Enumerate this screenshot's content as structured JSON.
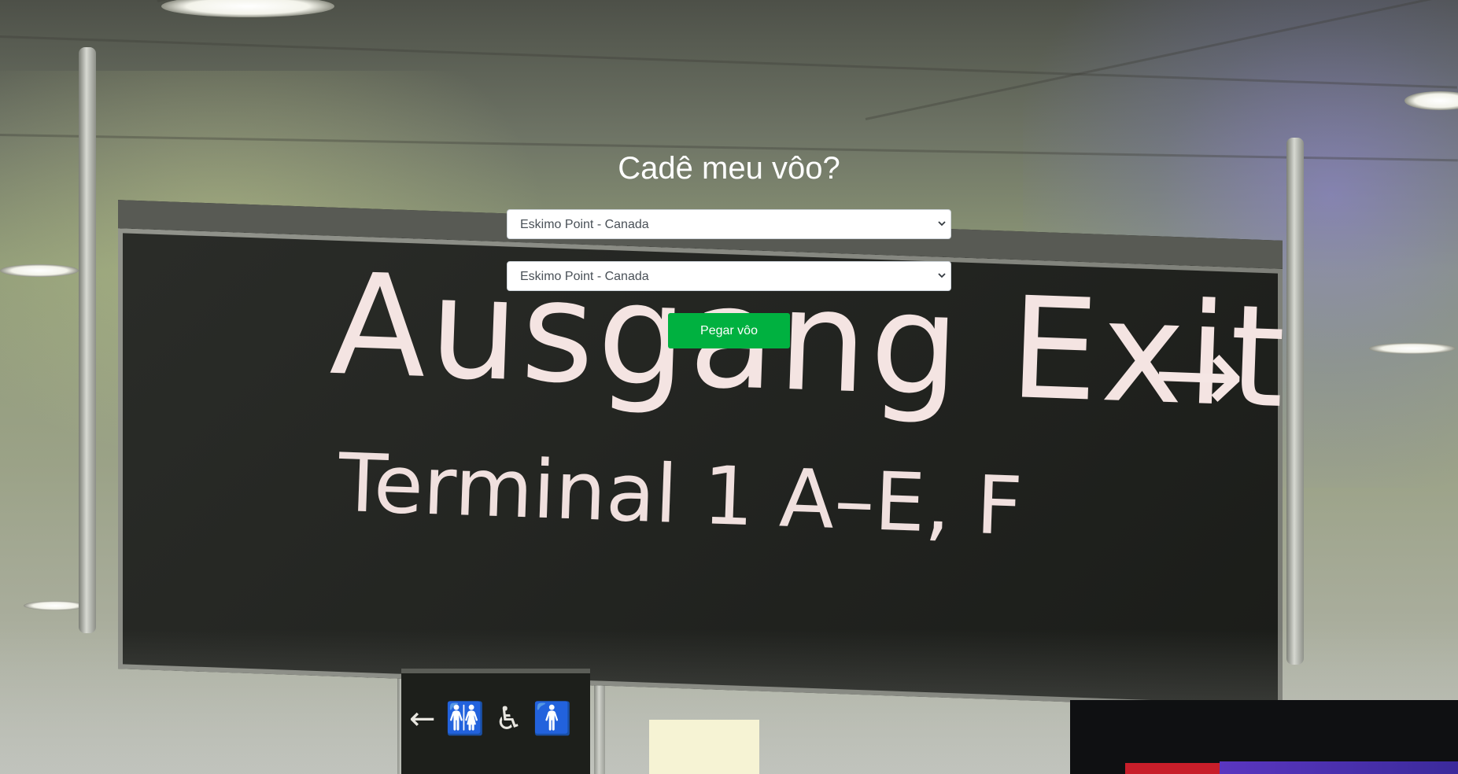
{
  "header": {
    "title": "Cadê meu vôo?"
  },
  "form": {
    "origin": {
      "selected": "Eskimo Point - Canada",
      "options": [
        "Eskimo Point - Canada"
      ]
    },
    "destination": {
      "selected": "Eskimo Point - Canada",
      "options": [
        "Eskimo Point - Canada"
      ]
    },
    "submit_label": "Pegar vôo"
  },
  "background": {
    "sign_main": "Ausgang Exit",
    "sign_sub": "Terminal 1 A–E, F",
    "sign_arrow": "→",
    "small_sign_symbols": "← 🚻 ♿ 🚹"
  },
  "colors": {
    "button_green": "#00b140",
    "title_text": "#ffffff",
    "select_text": "#495057"
  }
}
